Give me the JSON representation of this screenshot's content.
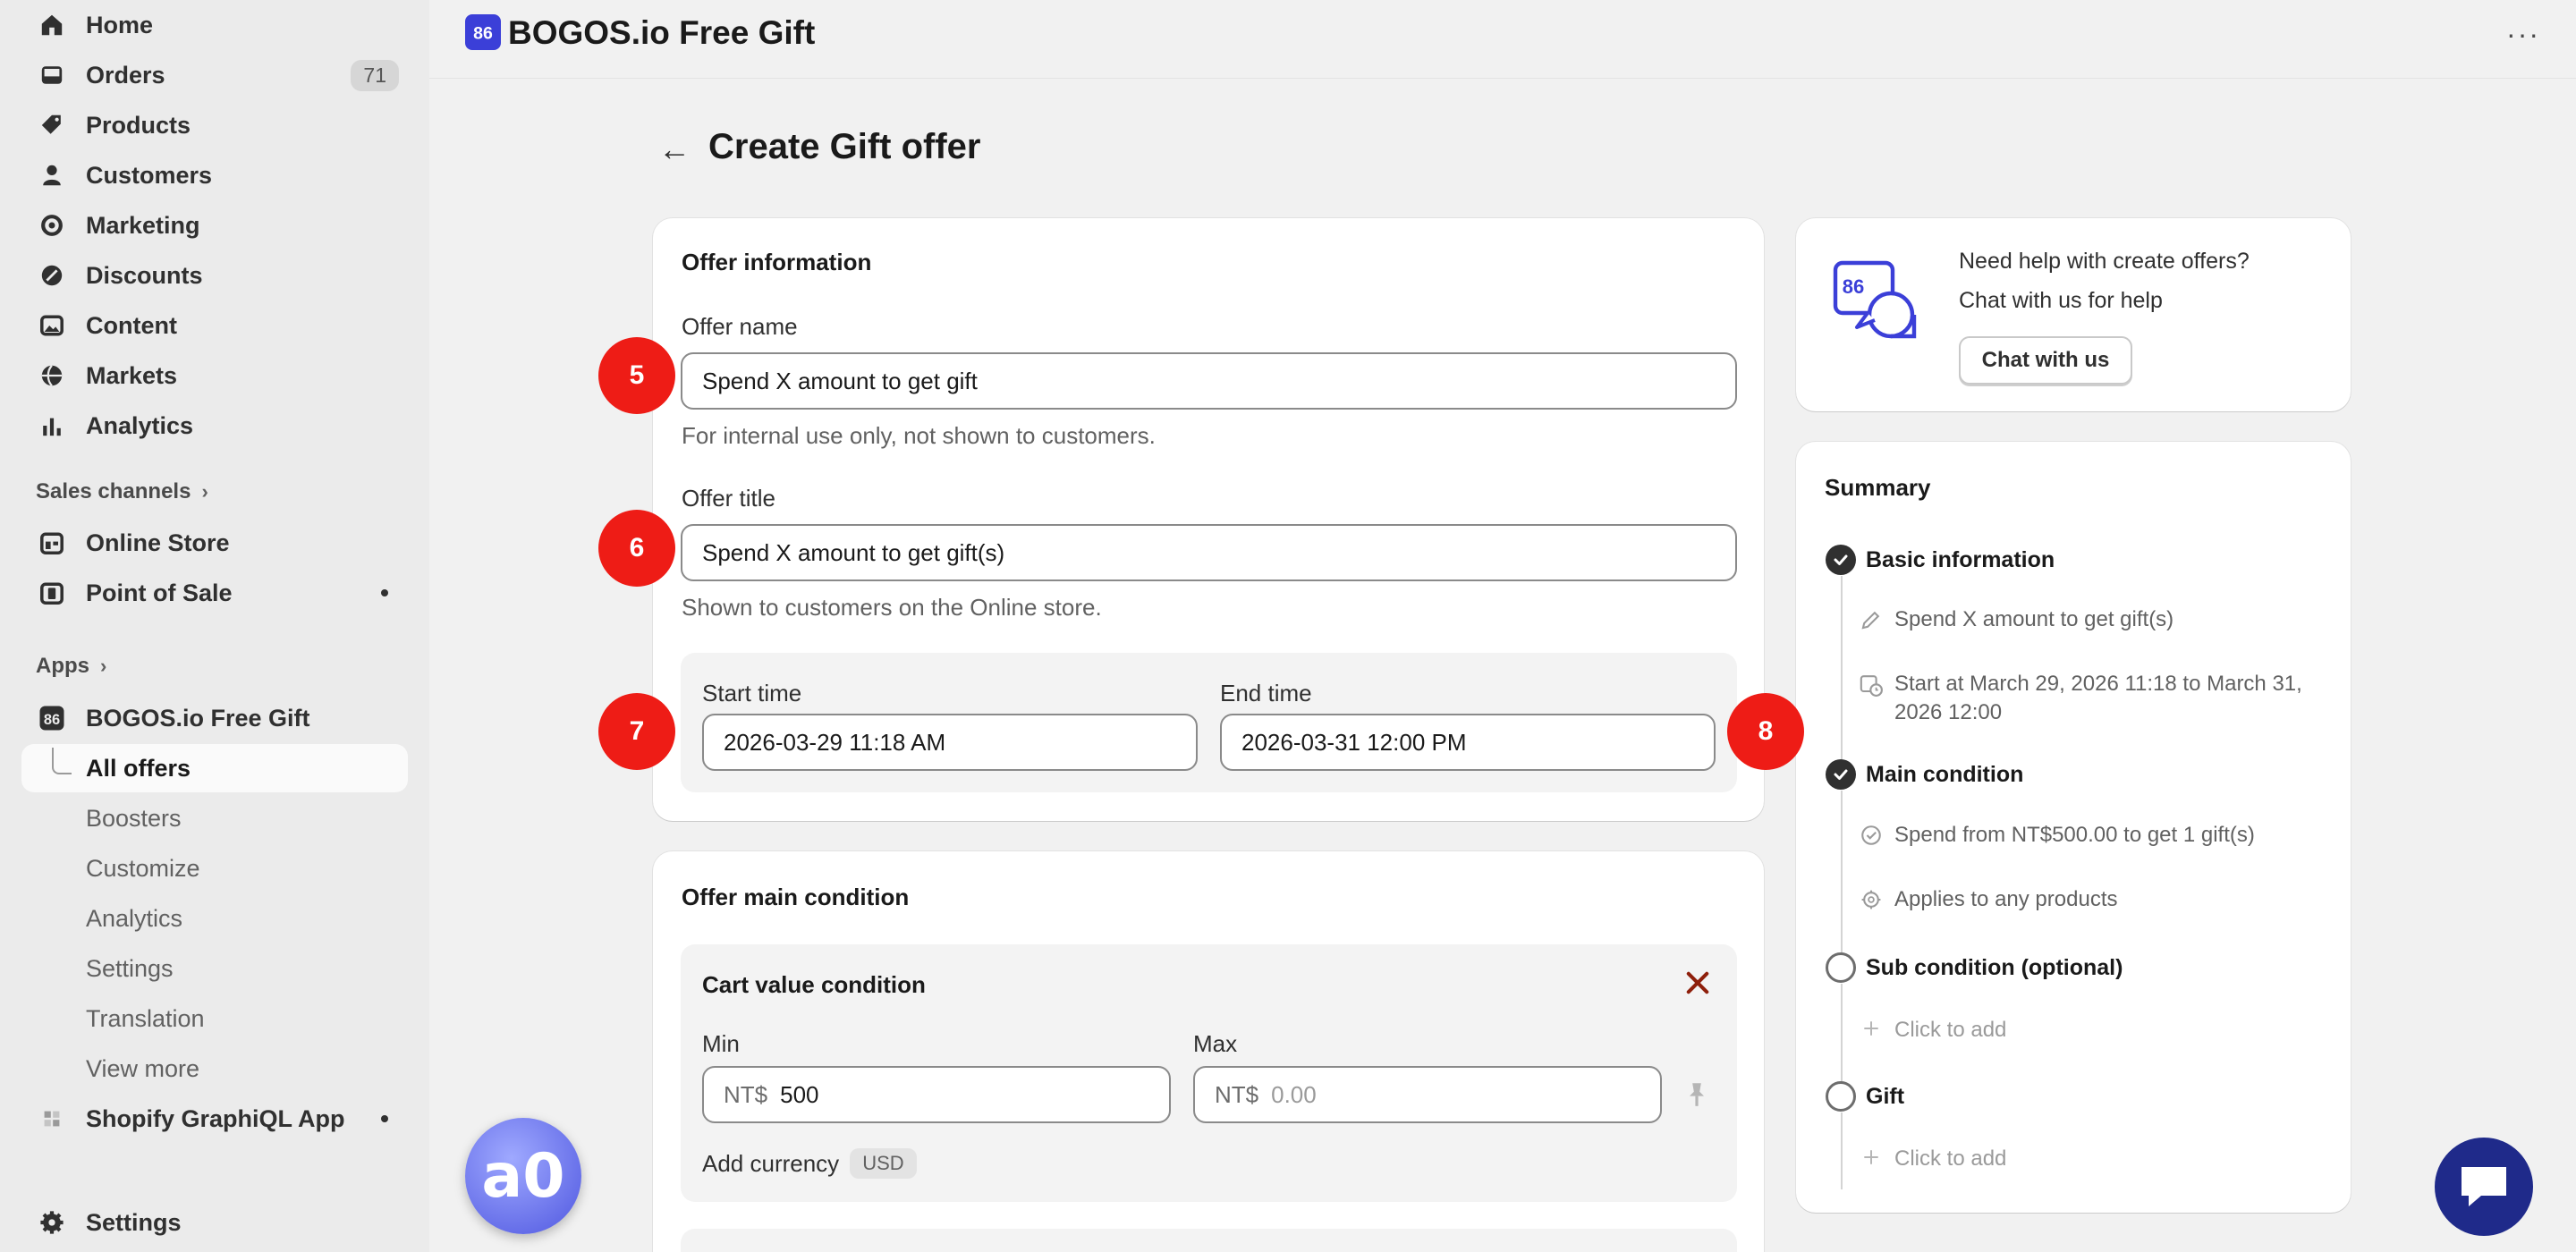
{
  "nav": {
    "home": "Home",
    "orders": "Orders",
    "orders_count": "71",
    "products": "Products",
    "customers": "Customers",
    "marketing": "Marketing",
    "discounts": "Discounts",
    "content": "Content",
    "markets": "Markets",
    "analytics": "Analytics",
    "sales_channels": "Sales channels",
    "online_store": "Online Store",
    "point_of_sale": "Point of Sale",
    "apps": "Apps",
    "app_name": "BOGOS.io Free Gift",
    "all_offers": "All offers",
    "boosters": "Boosters",
    "customize": "Customize",
    "app_analytics": "Analytics",
    "app_settings": "Settings",
    "translation": "Translation",
    "view_more": "View more",
    "graphiql": "Shopify GraphiQL App",
    "settings": "Settings"
  },
  "topbar": {
    "title": "BOGOS.io Free Gift",
    "more": "···"
  },
  "page": {
    "back": "←",
    "title": "Create Gift offer"
  },
  "offer_info": {
    "title": "Offer information",
    "name_label": "Offer name",
    "name_value": "Spend X amount to get gift",
    "name_help": "For internal use only, not shown to customers.",
    "title_label": "Offer title",
    "title_value": "Spend X amount to get gift(s)",
    "title_help": "Shown to customers on the Online store.",
    "start_label": "Start time",
    "start_value": "2026-03-29 11:18 AM",
    "end_label": "End time",
    "end_value": "2026-03-31 12:00 PM"
  },
  "main_condition": {
    "title": "Offer main condition",
    "cart_title": "Cart value condition",
    "min_label": "Min",
    "min_prefix": "NT$",
    "min_value": "500",
    "max_label": "Max",
    "max_prefix": "NT$",
    "max_placeholder": "0.00",
    "add_currency": "Add currency",
    "currency_badge": "USD"
  },
  "help": {
    "line1": "Need help with create offers?",
    "line2": "Chat with us for help",
    "button": "Chat with us"
  },
  "summary": {
    "title": "Summary",
    "basic": "Basic information",
    "basic_title": "Spend X amount to get gift(s)",
    "basic_time": "Start at March 29, 2026 11:18 to March 31, 2026 12:00",
    "main": "Main condition",
    "main_spend": "Spend from NT$500.00 to get 1 gift(s)",
    "main_applies": "Applies to any products",
    "sub": "Sub condition (optional)",
    "sub_add": "Click to add",
    "gift": "Gift",
    "gift_add": "Click to add"
  },
  "annotations": [
    "5",
    "6",
    "7",
    "8"
  ],
  "colors": {
    "accent": "#3b3fd8",
    "badge": "#ee1c16",
    "close": "#8e1f0b",
    "chat": "#1f2a8a"
  }
}
